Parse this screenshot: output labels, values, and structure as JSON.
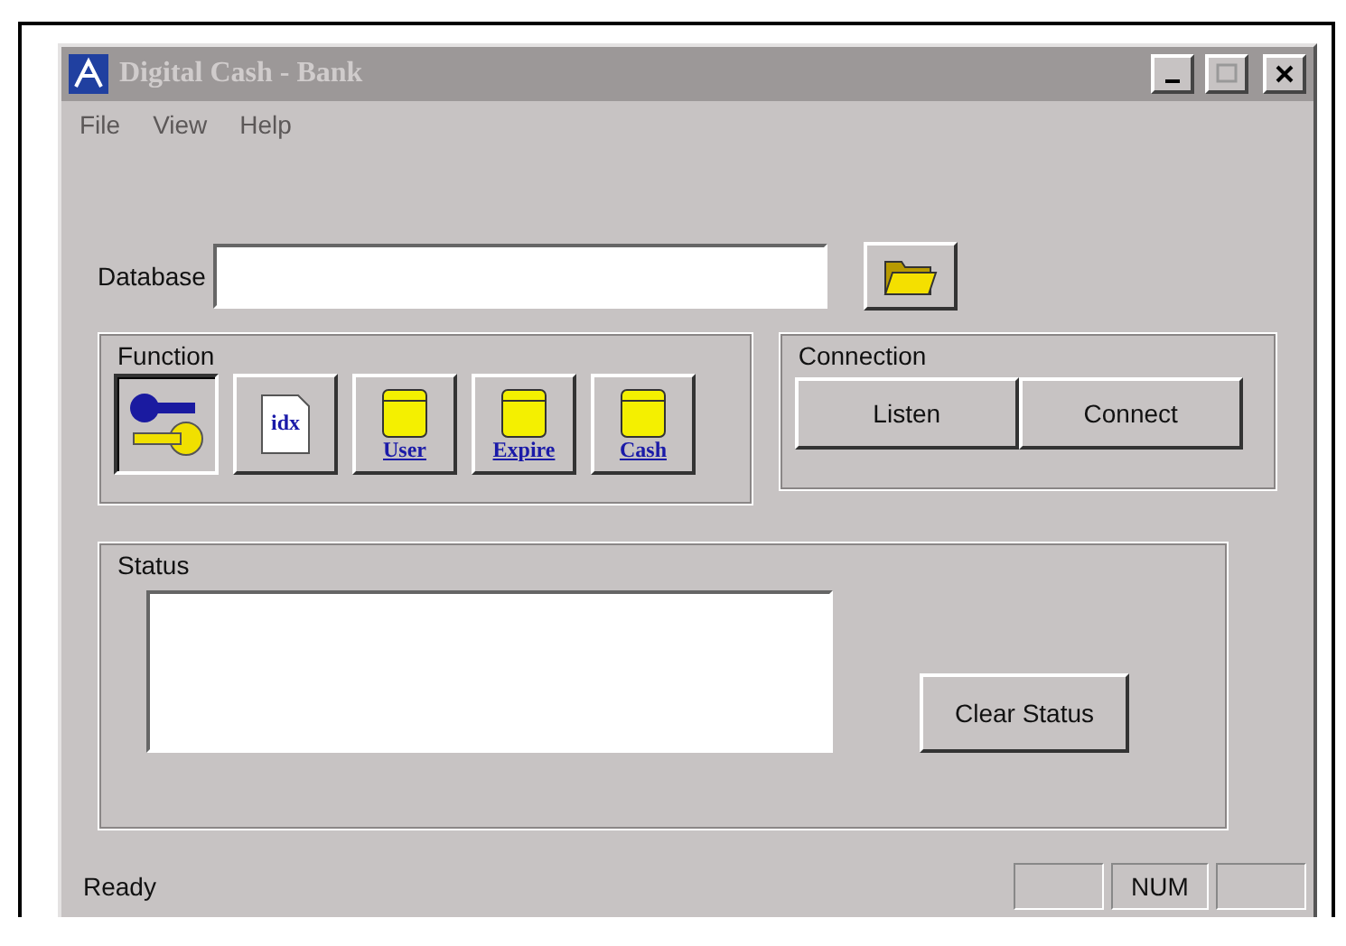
{
  "window": {
    "title": "Digital Cash - Bank",
    "active": false
  },
  "menu": [
    {
      "label": "File"
    },
    {
      "label": "View"
    },
    {
      "label": "Help"
    }
  ],
  "database": {
    "label": "Database"
  },
  "function": {
    "title": "Function",
    "buttons": [
      {
        "kind": "key",
        "selected": true
      },
      {
        "kind": "document",
        "label": "idx",
        "selected": false
      },
      {
        "kind": "drum",
        "label": "User",
        "selected": false
      },
      {
        "kind": "drum",
        "label": "Expire",
        "selected": false
      },
      {
        "kind": "drum",
        "label": "Cash",
        "selected": false
      }
    ]
  },
  "connection": {
    "title": "Connection",
    "buttons": [
      "Listen",
      "Connect"
    ]
  },
  "status": {
    "title": "Status",
    "button": "Clear Status"
  },
  "status_bar": {
    "text": "Ready",
    "panes": [
      {
        "kind": "empty"
      },
      {
        "kind": "text",
        "text": "NUM"
      },
      {
        "kind": "empty"
      }
    ]
  }
}
